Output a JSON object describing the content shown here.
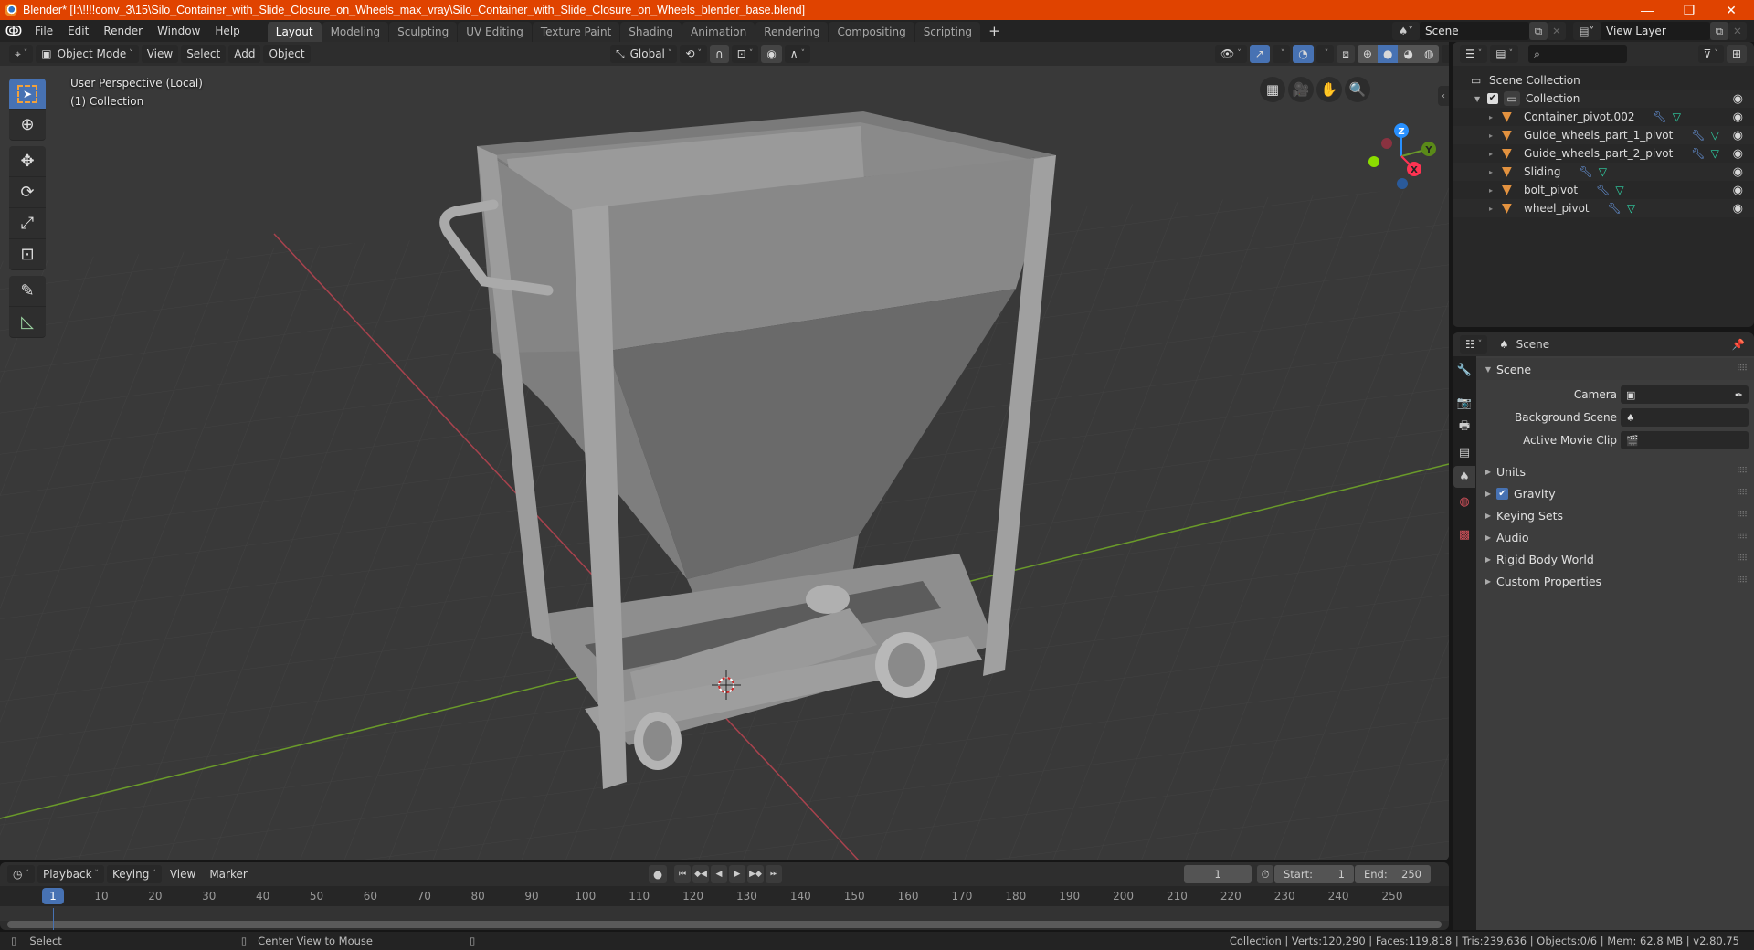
{
  "titlebar": {
    "title": "Blender* [I:\\!!!!conv_3\\15\\Silo_Container_with_Slide_Closure_on_Wheels_max_vray\\Silo_Container_with_Slide_Closure_on_Wheels_blender_base.blend]",
    "minimize": "—",
    "restore": "❐",
    "close": "✕"
  },
  "menu": {
    "items": [
      "File",
      "Edit",
      "Render",
      "Window",
      "Help"
    ]
  },
  "workspaces": {
    "tabs": [
      "Layout",
      "Modeling",
      "Sculpting",
      "UV Editing",
      "Texture Paint",
      "Shading",
      "Animation",
      "Rendering",
      "Compositing",
      "Scripting"
    ],
    "active": "Layout",
    "add": "+"
  },
  "scene_selector": {
    "value": "Scene"
  },
  "view_layer_selector": {
    "value": "View Layer"
  },
  "viewport": {
    "header": {
      "mode": "Object Mode",
      "menus": [
        "View",
        "Select",
        "Add",
        "Object"
      ],
      "orientation": "Global"
    },
    "overlay_text": {
      "perspective": "User Perspective (Local)",
      "collection": "(1) Collection"
    },
    "gizmo": {
      "x": "X",
      "y": "Y",
      "z": "Z"
    },
    "colors": {
      "x_axis": "#ff3352",
      "y_axis": "#8bdc00",
      "z_axis": "#2890ff",
      "grid_bg": "#393939"
    }
  },
  "timeline": {
    "menus": [
      "Playback",
      "Keying",
      "View",
      "Marker"
    ],
    "current_frame": "1",
    "start_label": "Start:",
    "start": "1",
    "end_label": "End:",
    "end": "250",
    "ticks": [
      "10",
      "20",
      "30",
      "40",
      "50",
      "60",
      "70",
      "80",
      "90",
      "100",
      "110",
      "120",
      "130",
      "140",
      "150",
      "160",
      "170",
      "180",
      "190",
      "200",
      "210",
      "220",
      "230",
      "240",
      "250"
    ],
    "playhead_label": "1"
  },
  "statusbar": {
    "left_action": "Select",
    "middle_action": "Center View to Mouse",
    "stats": "Collection | Verts:120,290 | Faces:119,818 | Tris:239,636 | Objects:0/6 | Mem: 62.8 MB | v2.80.75"
  },
  "outliner": {
    "root": "Scene Collection",
    "collection": "Collection",
    "objects": [
      {
        "name": "Container_pivot.002"
      },
      {
        "name": "Guide_wheels_part_1_pivot"
      },
      {
        "name": "Guide_wheels_part_2_pivot"
      },
      {
        "name": "Sliding"
      },
      {
        "name": "bolt_pivot"
      },
      {
        "name": "wheel_pivot"
      }
    ]
  },
  "properties": {
    "context": "Scene",
    "panel_title": "Scene",
    "fields": [
      {
        "label": "Camera",
        "value": ""
      },
      {
        "label": "Background Scene",
        "value": ""
      },
      {
        "label": "Active Movie Clip",
        "value": ""
      }
    ],
    "subpanels": [
      {
        "label": "Units",
        "checkbox": false
      },
      {
        "label": "Gravity",
        "checkbox": true,
        "checked": true
      },
      {
        "label": "Keying Sets",
        "checkbox": false
      },
      {
        "label": "Audio",
        "checkbox": false
      },
      {
        "label": "Rigid Body World",
        "checkbox": false
      },
      {
        "label": "Custom Properties",
        "checkbox": false
      }
    ]
  }
}
